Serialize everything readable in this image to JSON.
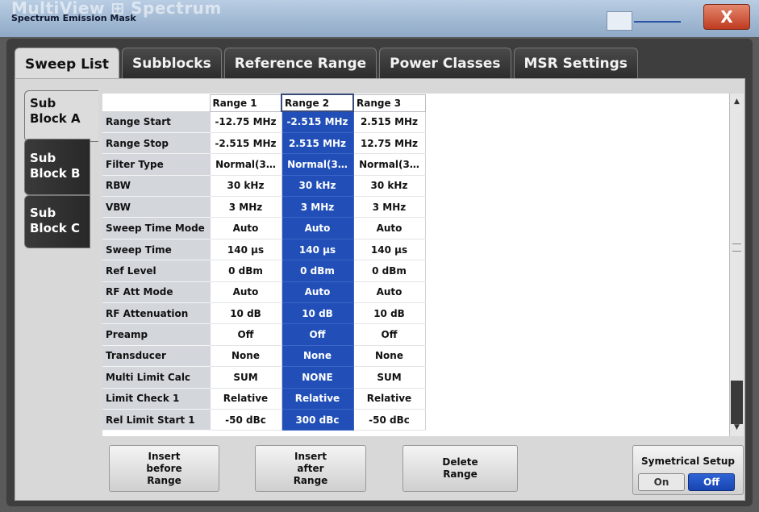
{
  "window": {
    "ghost_title": "MultiView  ⊞  Spectrum",
    "dialog_title": "Spectrum Emission Mask",
    "close_label": "X"
  },
  "tabs": [
    {
      "label": "Sweep List",
      "active": true
    },
    {
      "label": "Subblocks",
      "active": false
    },
    {
      "label": "Reference Range",
      "active": false
    },
    {
      "label": "Power Classes",
      "active": false
    },
    {
      "label": "MSR Settings",
      "active": false
    }
  ],
  "subblocks": [
    {
      "line1": "Sub",
      "line2": "Block A",
      "active": true
    },
    {
      "line1": "Sub",
      "line2": "Block B",
      "active": false
    },
    {
      "line1": "Sub",
      "line2": "Block C",
      "active": false
    }
  ],
  "table": {
    "columns": [
      "Range 1",
      "Range 2",
      "Range 3"
    ],
    "selected_column": 1,
    "rows": [
      {
        "label": "Range Start",
        "values": [
          "-12.75 MHz",
          "-2.515 MHz",
          "2.515 MHz"
        ]
      },
      {
        "label": "Range Stop",
        "values": [
          "-2.515 MHz",
          "2.515 MHz",
          "12.75 MHz"
        ]
      },
      {
        "label": "Filter Type",
        "values": [
          "Normal(3…",
          "Normal(3…",
          "Normal(3…"
        ]
      },
      {
        "label": "RBW",
        "values": [
          "30 kHz",
          "30 kHz",
          "30 kHz"
        ]
      },
      {
        "label": "VBW",
        "values": [
          "3 MHz",
          "3 MHz",
          "3 MHz"
        ]
      },
      {
        "label": "Sweep Time Mode",
        "values": [
          "Auto",
          "Auto",
          "Auto"
        ]
      },
      {
        "label": "Sweep Time",
        "values": [
          "140 µs",
          "140 µs",
          "140 µs"
        ]
      },
      {
        "label": "Ref Level",
        "values": [
          "0 dBm",
          "0 dBm",
          "0 dBm"
        ]
      },
      {
        "label": "RF Att Mode",
        "values": [
          "Auto",
          "Auto",
          "Auto"
        ]
      },
      {
        "label": "RF Attenuation",
        "values": [
          "10 dB",
          "10 dB",
          "10 dB"
        ]
      },
      {
        "label": "Preamp",
        "values": [
          "Off",
          "Off",
          "Off"
        ]
      },
      {
        "label": "Transducer",
        "values": [
          "None",
          "None",
          "None"
        ]
      },
      {
        "label": "Multi Limit Calc",
        "values": [
          "SUM",
          "NONE",
          "SUM"
        ]
      },
      {
        "label": "Limit Check 1",
        "values": [
          "Relative",
          "Relative",
          "Relative"
        ]
      },
      {
        "label": "Rel Limit Start 1",
        "values": [
          "-50 dBc",
          "300 dBc",
          "-50 dBc"
        ]
      }
    ]
  },
  "buttons": {
    "insert_before": [
      "Insert",
      "before",
      "Range"
    ],
    "insert_after": [
      "Insert",
      "after",
      "Range"
    ],
    "delete": [
      "Delete",
      "Range"
    ]
  },
  "symmetrical": {
    "title": "Symetrical Setup",
    "on_label": "On",
    "off_label": "Off",
    "selected": "Off"
  },
  "colors": {
    "selection": "#214fb7",
    "label_cell": "#d3d7dc"
  },
  "icons": {
    "scroll_up": "▲",
    "scroll_down": "▼"
  }
}
